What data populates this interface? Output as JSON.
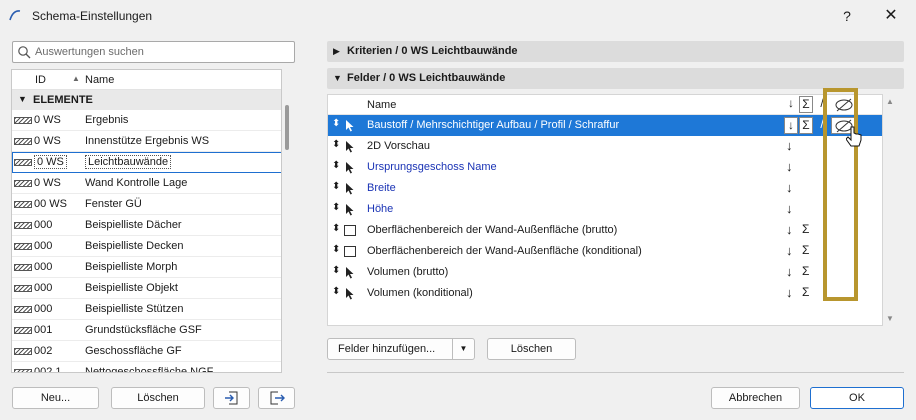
{
  "window": {
    "title": "Schema-Einstellungen",
    "help": "?",
    "close": "✕"
  },
  "search": {
    "placeholder": "Auswertungen suchen",
    "icon": "search-icon"
  },
  "list": {
    "col_id": "ID",
    "col_name": "Name",
    "group": "ELEMENTE",
    "rows": [
      {
        "id": "0 WS",
        "name": "Ergebnis"
      },
      {
        "id": "0 WS",
        "name": "Innenstütze Ergebnis WS"
      },
      {
        "id": "0 WS",
        "name": "Leichtbauwände",
        "selected": true
      },
      {
        "id": "0 WS",
        "name": "Wand Kontrolle Lage"
      },
      {
        "id": "00 WS",
        "name": "Fenster GÜ"
      },
      {
        "id": "000",
        "name": "Beispielliste Dächer"
      },
      {
        "id": "000",
        "name": "Beispielliste Decken"
      },
      {
        "id": "000",
        "name": "Beispielliste Morph"
      },
      {
        "id": "000",
        "name": "Beispielliste Objekt"
      },
      {
        "id": "000",
        "name": "Beispielliste Stützen"
      },
      {
        "id": "001",
        "name": "Grundstücksfläche GSF"
      },
      {
        "id": "002",
        "name": "Geschossfläche GF"
      },
      {
        "id": "002.1",
        "name": "Nettogeschossfläche NGF"
      }
    ]
  },
  "left_buttons": {
    "new": "Neu...",
    "delete": "Löschen"
  },
  "sections": {
    "criteria": "Kriterien / 0 WS Leichtbauwände",
    "fields": "Felder / 0 WS Leichtbauwände"
  },
  "fields": {
    "header": "Name",
    "rows": [
      {
        "name": "Baustoff / Mehrschichtiger Aufbau / Profil / Schraffur",
        "selected": true,
        "blue": false,
        "sort": "↓",
        "sum": "Σ",
        "icon": "arrow"
      },
      {
        "name": "2D Vorschau",
        "blue": false,
        "sort": "↓",
        "sum": "",
        "icon": "arrow"
      },
      {
        "name": "Ursprungsgeschoss Name",
        "blue": true,
        "sort": "↓",
        "sum": "",
        "icon": "arrow"
      },
      {
        "name": "Breite",
        "blue": true,
        "sort": "↓",
        "sum": "",
        "icon": "arrow"
      },
      {
        "name": "Höhe",
        "blue": true,
        "sort": "↓",
        "sum": "",
        "icon": "arrow"
      },
      {
        "name": "Oberflächenbereich der Wand-Außenfläche (brutto)",
        "blue": false,
        "sort": "↓",
        "sum": "Σ",
        "icon": "surface"
      },
      {
        "name": "Oberflächenbereich der Wand-Außenfläche (konditional)",
        "blue": false,
        "sort": "↓",
        "sum": "Σ",
        "icon": "surface"
      },
      {
        "name": "Volumen (brutto)",
        "blue": false,
        "sort": "↓",
        "sum": "Σ",
        "icon": "arrow"
      },
      {
        "name": "Volumen (konditional)",
        "blue": false,
        "sort": "↓",
        "sum": "Σ",
        "icon": "arrow"
      }
    ]
  },
  "field_buttons": {
    "add": "Felder hinzufügen...",
    "delete": "Löschen"
  },
  "footer": {
    "cancel": "Abbrechen",
    "ok": "OK"
  },
  "colors": {
    "accent": "#1e78d7",
    "highlight": "#b8962e",
    "blue_text": "#1a33b5"
  }
}
